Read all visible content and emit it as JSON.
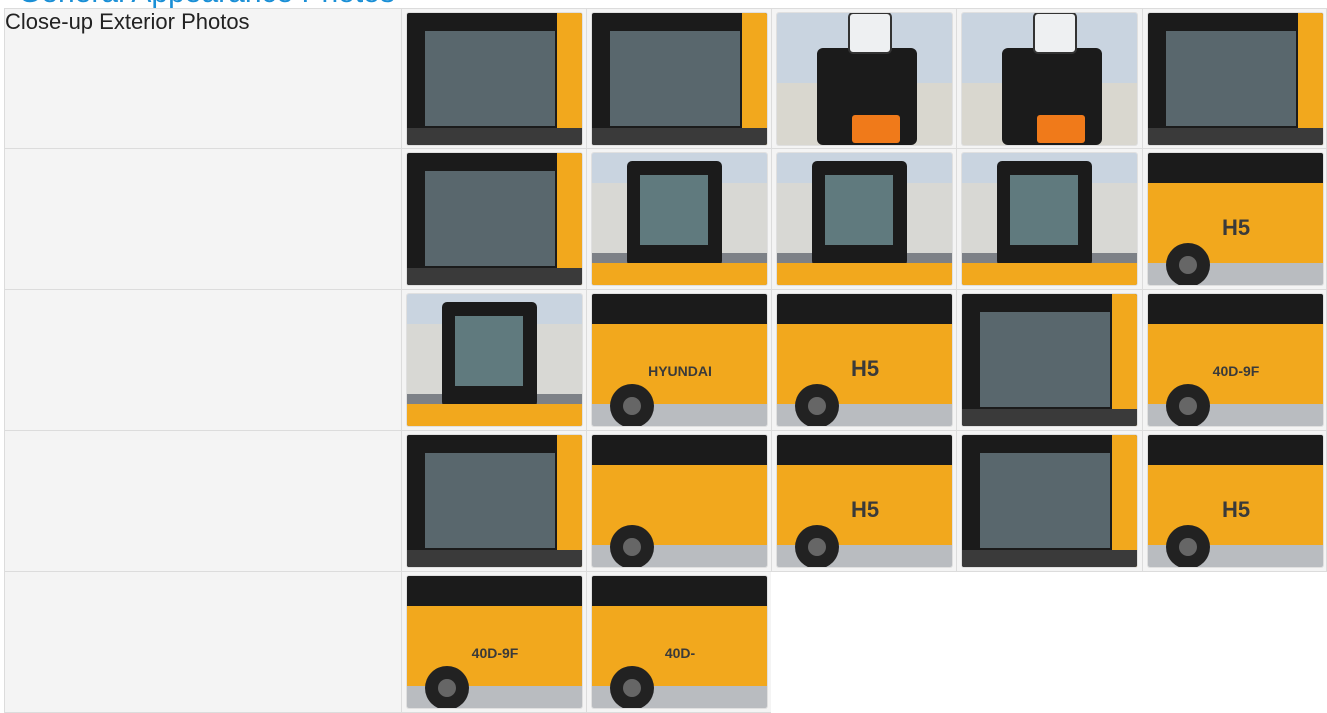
{
  "section": {
    "title": "General Appearance Photos"
  },
  "rows": [
    {
      "label": "Close-up Exterior Photos"
    },
    {
      "label": ""
    },
    {
      "label": ""
    },
    {
      "label": ""
    },
    {
      "label": ""
    }
  ],
  "photos": [
    {
      "desc": "roof-window",
      "tone": "cab"
    },
    {
      "desc": "cab-glass",
      "tone": "cab"
    },
    {
      "desc": "work-light",
      "tone": "sky"
    },
    {
      "desc": "work-light",
      "tone": "sky"
    },
    {
      "desc": "cab-corner",
      "tone": "cab"
    },
    {
      "desc": "door-window",
      "tone": "cab"
    },
    {
      "desc": "cab-front",
      "tone": "yard"
    },
    {
      "desc": "cab-side",
      "tone": "yard"
    },
    {
      "desc": "cab-rear",
      "tone": "yard"
    },
    {
      "desc": "counterweight-side",
      "tone": "yellow",
      "text": "H5"
    },
    {
      "desc": "rear-cab",
      "tone": "yard"
    },
    {
      "desc": "counterweight-rear",
      "tone": "yellow",
      "text": "HYUNDAI"
    },
    {
      "desc": "counterweight-corner",
      "tone": "yellow",
      "text": "H5"
    },
    {
      "desc": "cab-interior",
      "tone": "cab"
    },
    {
      "desc": "side-body",
      "tone": "yellow",
      "text": "40D-9F"
    },
    {
      "desc": "cab-door",
      "tone": "cab"
    },
    {
      "desc": "mast-side",
      "tone": "yellow"
    },
    {
      "desc": "body-side",
      "tone": "yellow",
      "text": "H5"
    },
    {
      "desc": "cab-door-open",
      "tone": "cab"
    },
    {
      "desc": "body-side",
      "tone": "yellow",
      "text": "H5"
    },
    {
      "desc": "side-body",
      "tone": "yellow",
      "text": "40D-9F"
    },
    {
      "desc": "side-body",
      "tone": "yellow",
      "text": "40D-"
    }
  ],
  "colors": {
    "accent": "#1a8fd6",
    "forklift_yellow": "#f2a81d",
    "cab_black": "#1b1b1b",
    "sky": "#c9d4e0",
    "yard_gray": "#7d8187"
  }
}
